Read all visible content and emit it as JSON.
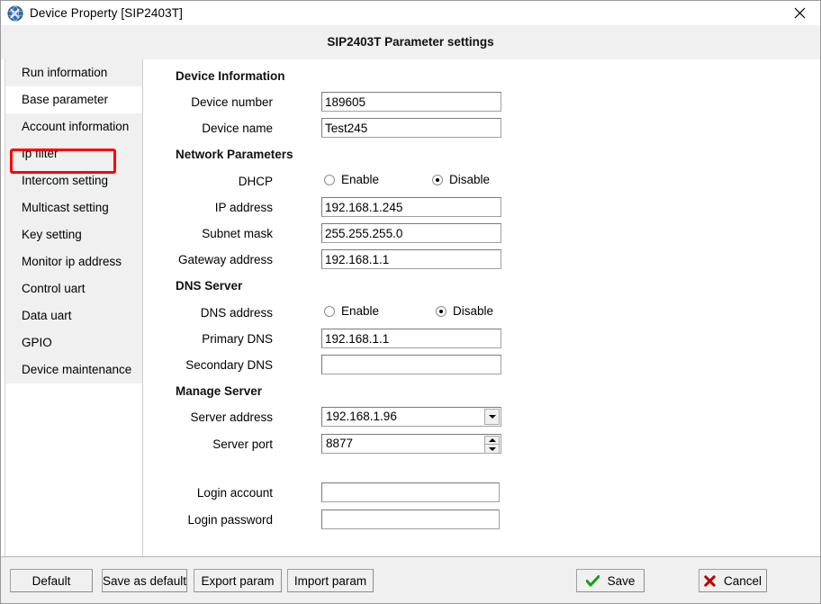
{
  "window": {
    "title": "Device Property [SIP2403T]",
    "icon": "device-globe-tools-icon",
    "close_label": "✕"
  },
  "header": {
    "title": "SIP2403T Parameter settings"
  },
  "sidebar": {
    "items": [
      {
        "label": "Run information",
        "selected": false
      },
      {
        "label": "Base parameter",
        "selected": true
      },
      {
        "label": "Account information",
        "selected": false
      },
      {
        "label": "Ip filter",
        "selected": false
      },
      {
        "label": "Intercom setting",
        "selected": false
      },
      {
        "label": "Multicast setting",
        "selected": false
      },
      {
        "label": "Key setting",
        "selected": false
      },
      {
        "label": "Monitor ip address",
        "selected": false
      },
      {
        "label": "Control uart",
        "selected": false
      },
      {
        "label": "Data uart",
        "selected": false
      },
      {
        "label": "GPIO",
        "selected": false
      },
      {
        "label": "Device maintenance",
        "selected": false
      }
    ],
    "highlight_color": "#ff0000"
  },
  "form": {
    "groups": {
      "device_information": "Device Information",
      "network_parameters": "Network Parameters",
      "dns_server": "DNS Server",
      "manage_server": "Manage Server"
    },
    "device_number": {
      "label": "Device number",
      "value": "189605",
      "placeholder": ""
    },
    "device_name": {
      "label": "Device name",
      "value": "Test245",
      "placeholder": ""
    },
    "dhcp": {
      "label": "DHCP",
      "enable_label": "Enable",
      "disable_label": "Disable",
      "selected": "Disable"
    },
    "ip_address": {
      "label": "IP address",
      "value": "192.168.1.245",
      "placeholder": ""
    },
    "subnet_mask": {
      "label": "Subnet mask",
      "value": "255.255.255.0",
      "placeholder": ""
    },
    "gateway_address": {
      "label": "Gateway address",
      "value": "192.168.1.1",
      "placeholder": ""
    },
    "dns_address": {
      "label": "DNS address",
      "enable_label": "Enable",
      "disable_label": "Disable",
      "selected": "Disable"
    },
    "primary_dns": {
      "label": "Primary DNS",
      "value": "192.168.1.1",
      "placeholder": ""
    },
    "secondary_dns": {
      "label": "Secondary DNS",
      "value": "",
      "placeholder": ""
    },
    "server_address": {
      "label": "Server address",
      "value": "192.168.1.96",
      "options": [
        "192.168.1.96"
      ]
    },
    "server_port": {
      "label": "Server port",
      "value": "8877",
      "placeholder": ""
    },
    "login_account": {
      "label": "Login account",
      "value": "",
      "placeholder": ""
    },
    "login_password": {
      "label": "Login password",
      "value": "",
      "placeholder": ""
    }
  },
  "footer": {
    "default_label": "Default",
    "save_as_default_label": "Save as default",
    "export_param_label": "Export param",
    "import_param_label": "Import param",
    "save_label": "Save",
    "cancel_label": "Cancel",
    "save_icon_color": "#12a012",
    "cancel_icon_color": "#c00000"
  }
}
